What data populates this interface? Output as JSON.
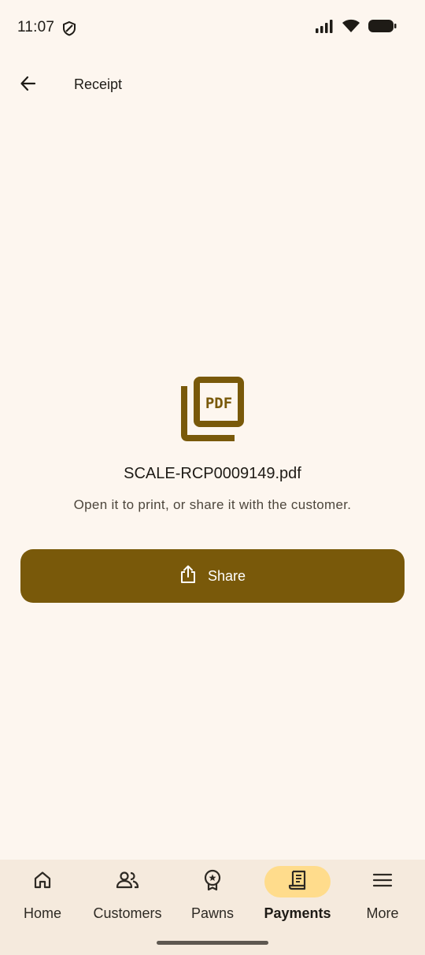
{
  "status_bar": {
    "time": "11:07",
    "icons": [
      "shield-icon",
      "signal-icon",
      "wifi-icon",
      "battery-icon"
    ]
  },
  "app_bar": {
    "back_icon": "arrow-left-icon",
    "title": "Receipt"
  },
  "content": {
    "file_icon": "pdf-file-icon",
    "file_icon_text": "PDF",
    "file_name": "SCALE-RCP0009149.pdf",
    "hint": "Open it to print, or share it with the customer."
  },
  "share_button": {
    "icon": "share-icon",
    "label": "Share"
  },
  "bottom_nav": {
    "items": [
      {
        "label": "Home",
        "icon": "home-icon",
        "active": false
      },
      {
        "label": "Customers",
        "icon": "people-icon",
        "active": false
      },
      {
        "label": "Pawns",
        "icon": "badge-icon",
        "active": false
      },
      {
        "label": "Payments",
        "icon": "receipt-icon",
        "active": true
      },
      {
        "label": "More",
        "icon": "menu-icon",
        "active": false
      }
    ]
  },
  "colors": {
    "background": "#FDF6EF",
    "primary": "#79590A",
    "active_indicator": "#FFDC8C",
    "nav_background": "#F5EADD"
  }
}
